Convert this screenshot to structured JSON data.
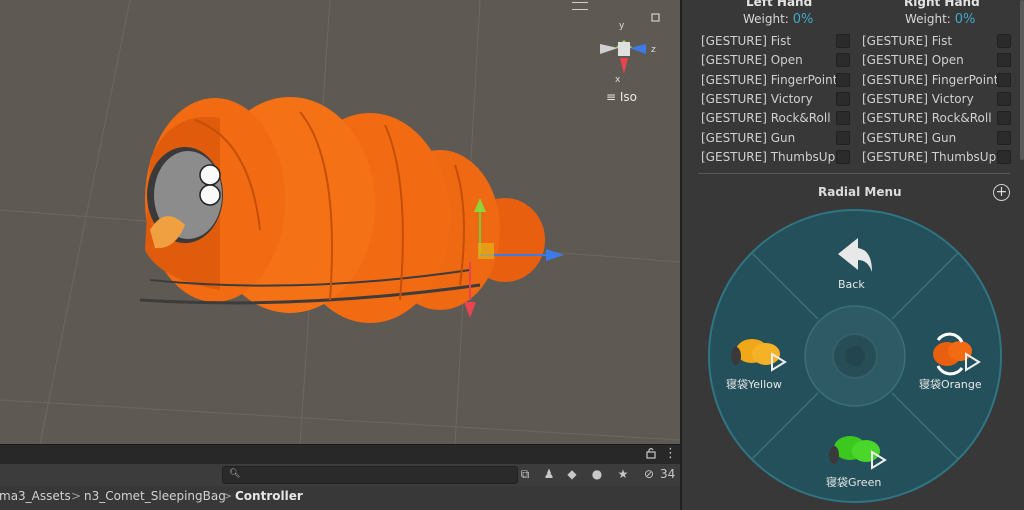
{
  "scene": {
    "orientation_label": "Iso",
    "axis_labels": {
      "x": "x",
      "y": "y",
      "z": "z"
    },
    "gizmo_colors": {
      "x": "#e8434f",
      "y": "#8ed33c",
      "z": "#3c7ae8"
    },
    "bag_color": "#f26b12"
  },
  "project": {
    "search_placeholder": "",
    "hidden_count": "34",
    "breadcrumb": [
      "ma3_Assets",
      "n3_Comet_SleepingBag",
      "Controller"
    ],
    "breadcrumb_sep": ">"
  },
  "inspector": {
    "left_hand": {
      "title": "Left Hand",
      "weight_label": "Weight:",
      "weight_value": "0%",
      "gestures": [
        "[GESTURE] Fist",
        "[GESTURE] Open",
        "[GESTURE] FingerPoint",
        "[GESTURE] Victory",
        "[GESTURE] Rock&Roll",
        "[GESTURE] Gun",
        "[GESTURE] ThumbsUp"
      ]
    },
    "right_hand": {
      "title": "Right Hand",
      "weight_label": "Weight:",
      "weight_value": "0%",
      "gestures": [
        "[GESTURE] Fist",
        "[GESTURE] Open",
        "[GESTURE] FingerPoint",
        "[GESTURE] Victory",
        "[GESTURE] Rock&Roll",
        "[GESTURE] Gun",
        "[GESTURE] ThumbsUp"
      ]
    },
    "accent": "#42a8c8"
  },
  "radial_menu": {
    "title": "Radial Menu",
    "back_label": "Back",
    "items": [
      {
        "label": "寝袋Yellow",
        "color": "#f0a818"
      },
      {
        "label": "寝袋Orange",
        "color": "#f26b12"
      },
      {
        "label": "寝袋Green",
        "color": "#3cc81e"
      }
    ],
    "ring_color": "#2a5f6b"
  }
}
